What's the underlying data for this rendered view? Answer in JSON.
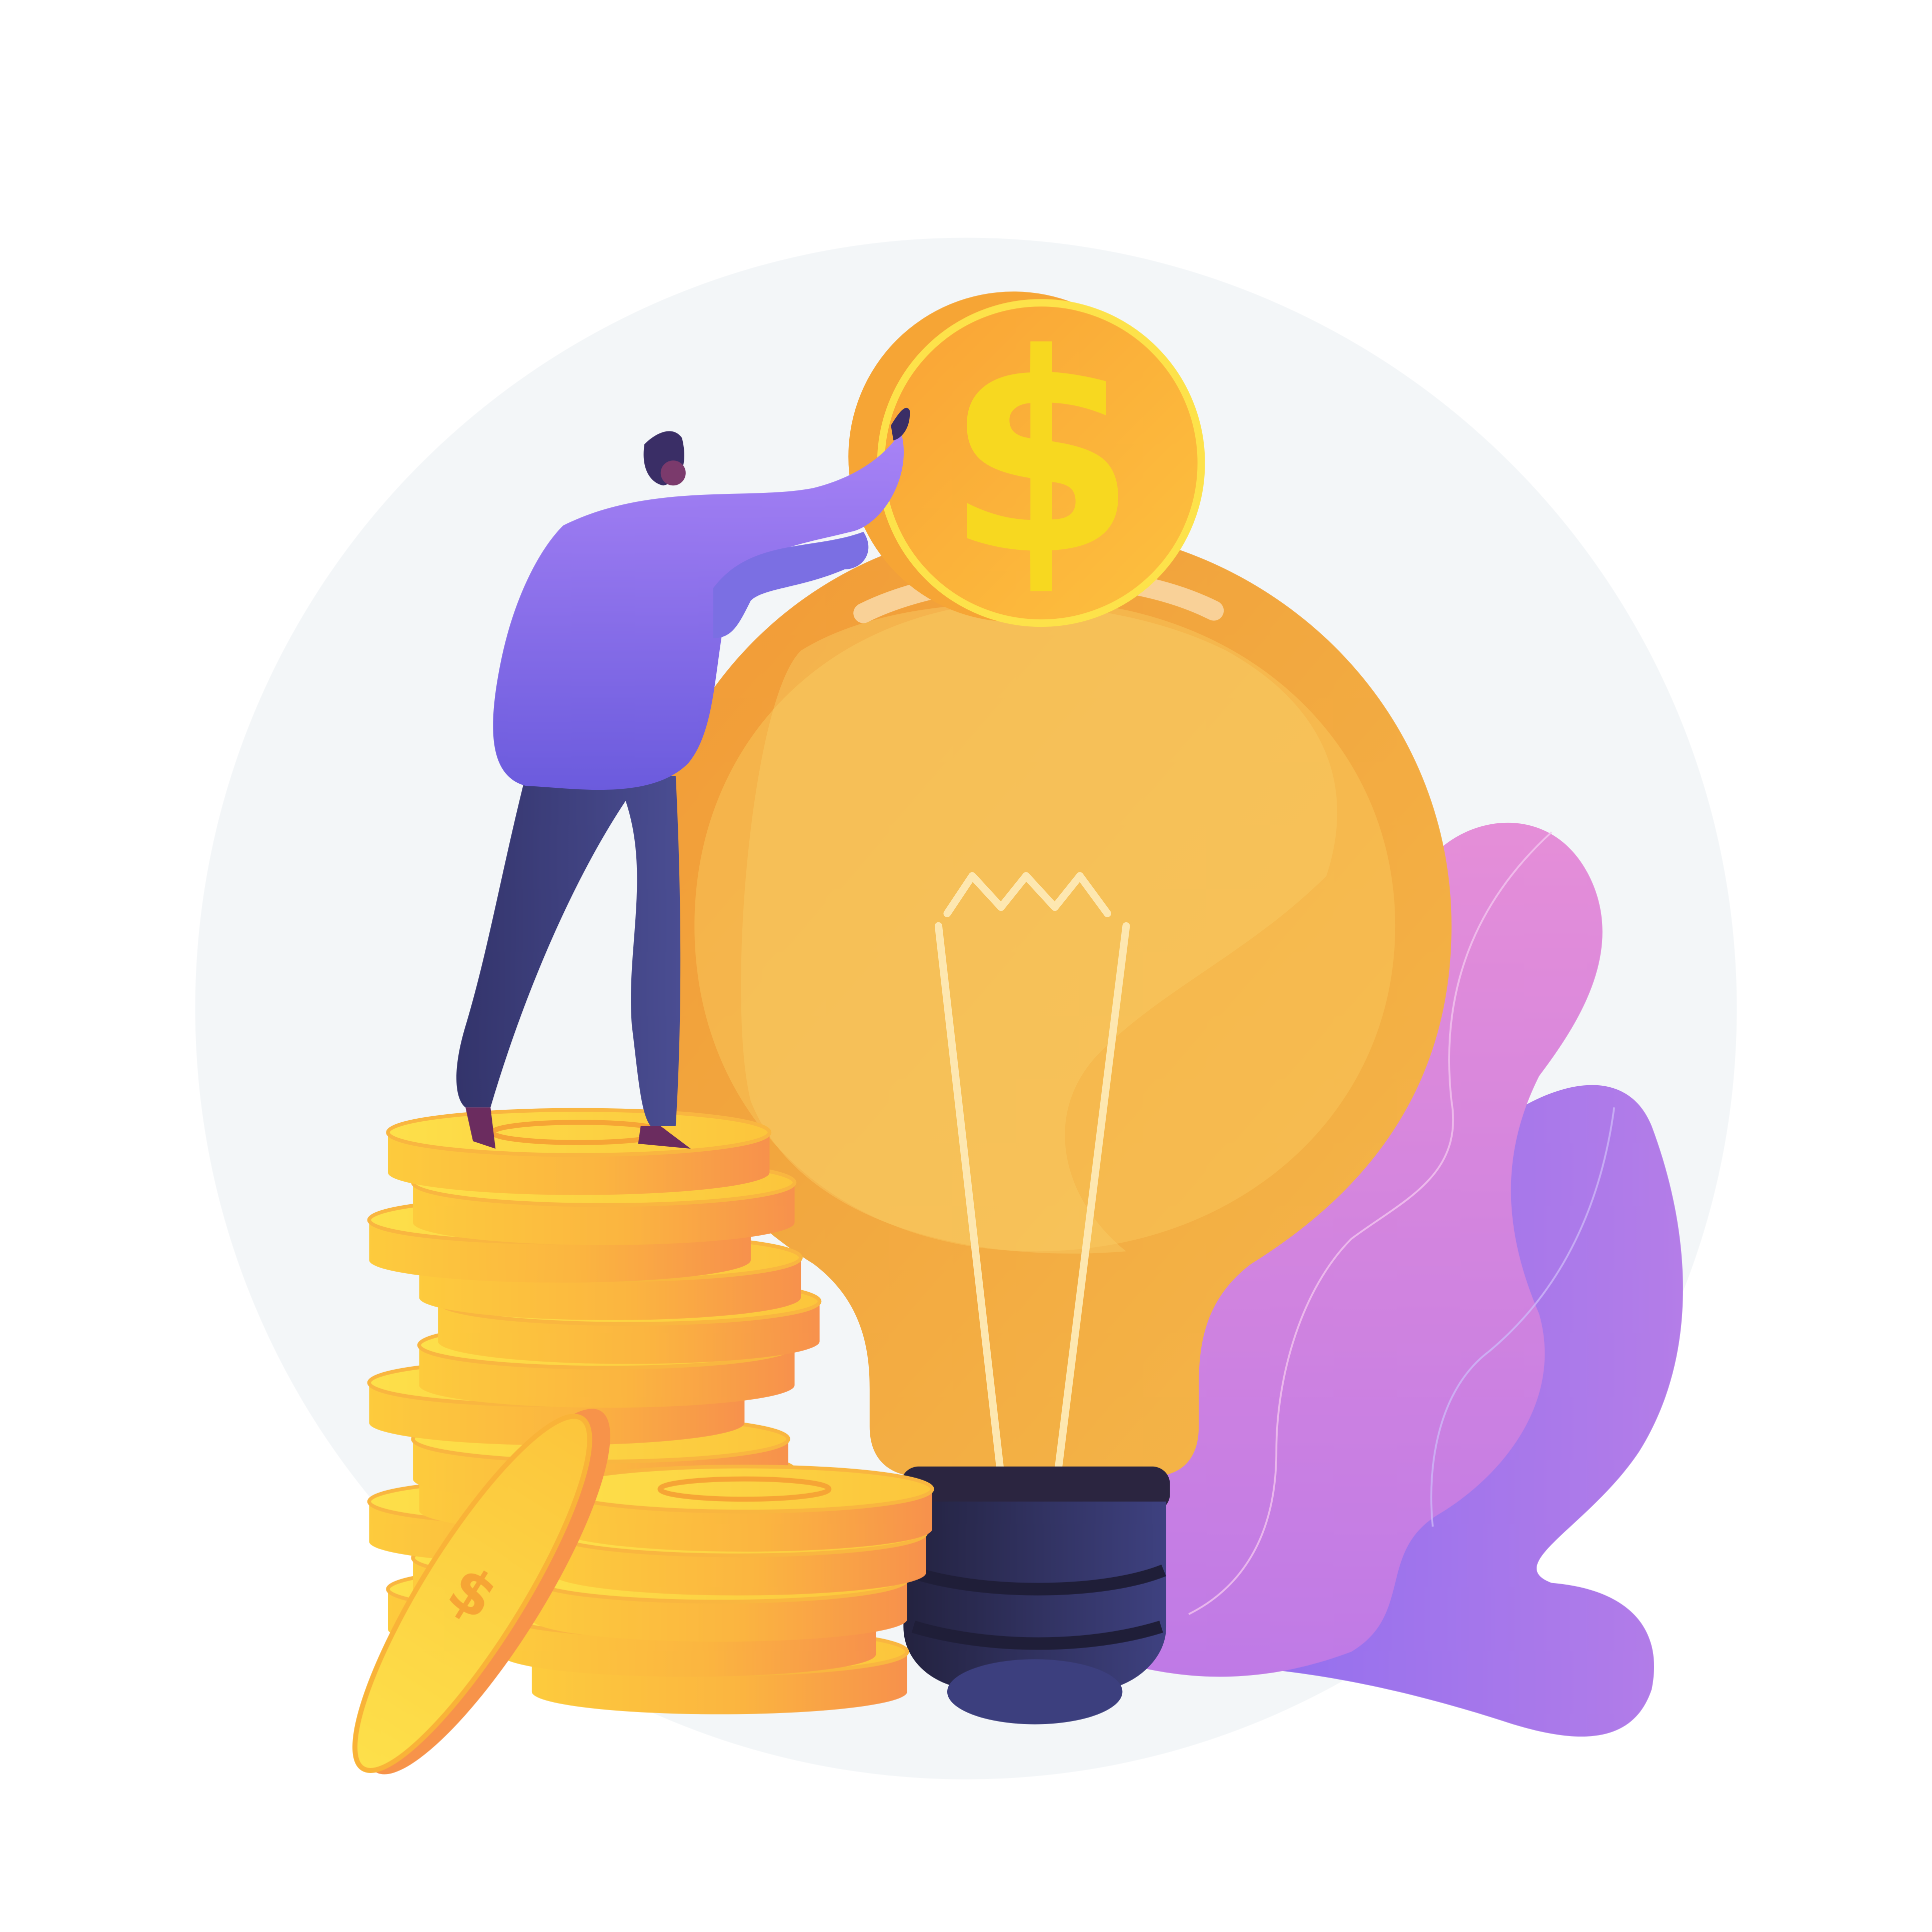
{
  "illustration": {
    "subject": "person-depositing-coin-into-lightbulb",
    "coin_symbol": "$",
    "colors": {
      "background": "#ffffff",
      "backdrop_circle": "#f3f6f8",
      "bulb_orange": "#f2a23a",
      "bulb_highlight": "#f7c45a",
      "coin_gold": "#fdc93a",
      "coin_orange": "#f7934a",
      "coin_symbol": "#f6d324",
      "socket_navy": "#33356a",
      "shirt_purple": "#8f7ae8",
      "pants_navy": "#3b3d78",
      "leaf_pink": "#e08bdb",
      "leaf_violet": "#9b74ec"
    }
  }
}
